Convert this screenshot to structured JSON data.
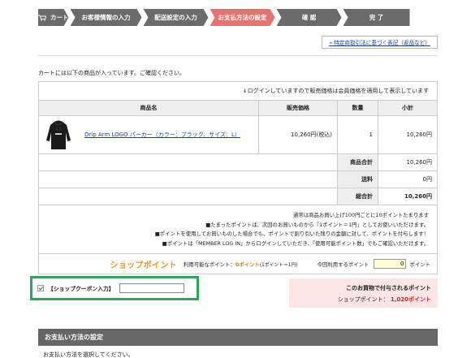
{
  "steps": [
    {
      "label": "カート",
      "icon": "cart-icon",
      "active": false
    },
    {
      "label": "お客様情報の入力",
      "active": false
    },
    {
      "label": "配送設定の入力",
      "active": false
    },
    {
      "label": "お支払方法の設定",
      "active": true
    },
    {
      "label": "確 認",
      "active": false
    },
    {
      "label": "完 了",
      "active": false
    }
  ],
  "colors": {
    "step_default": "#6b6b6b",
    "step_active": "#e8726f",
    "coupon_border": "#2da55a",
    "point_orange": "#e87a10",
    "earn_bg": "#fbe5e6"
  },
  "law_link": "» 特定商取引法に基づく表記（返品など）",
  "intro": "カートには以下の商品が入っています。ご確認ください。",
  "cart": {
    "login_note": "↓ログインしていますので販売価格は会員価格を適用して表示しています",
    "headers": {
      "name": "商品名",
      "price": "販売価格",
      "qty": "数量",
      "subtotal": "小計"
    },
    "item": {
      "name": "Drip Arm LOGO パーカー（カラー：ブラック、サイズ：L）",
      "price": "10,260円(税込)",
      "qty": "1",
      "subtotal": "10,260円",
      "thumb_icon": "hoodie-image"
    },
    "summary": [
      {
        "label": "商品合計",
        "value": "10,260円"
      },
      {
        "label": "送料",
        "value": "0円"
      },
      {
        "label": "総合計",
        "value": "10,260円"
      }
    ],
    "points_info": [
      "通常は商品お買い上げ100円ごとに10ポイントたまります",
      "■たまったポイントは、次回のお買いものから「1ポイント＝1円」としてお使いいただけます。",
      "■ポイントを使用してお買いものした場合でも、ポイントで割り引いた残りの金額に対して、ポイントを付与します！",
      "■ポイントは「MEMBER LOG IN」からログインしていただき、「使用可能ポイント数」でもご確認いただけます。"
    ],
    "point_bar": {
      "logo": "ショップポイント",
      "avail_label": "利用可能なポイント：",
      "avail_value": "0ポイント",
      "rate": "(1ポイント＝1円)",
      "use_label": "今回利用するポイント",
      "use_value": "0",
      "use_unit": "ポイント"
    }
  },
  "coupon": {
    "label": "【ショップクーポン入力】",
    "value": ""
  },
  "earn": {
    "title": "このお買物で付与されるポイント",
    "label": "ショップポイント：",
    "value": "1,020ポイント"
  },
  "payment": {
    "header": "お支払い方法の設定",
    "note": "お支払い方法を選択してください。"
  }
}
